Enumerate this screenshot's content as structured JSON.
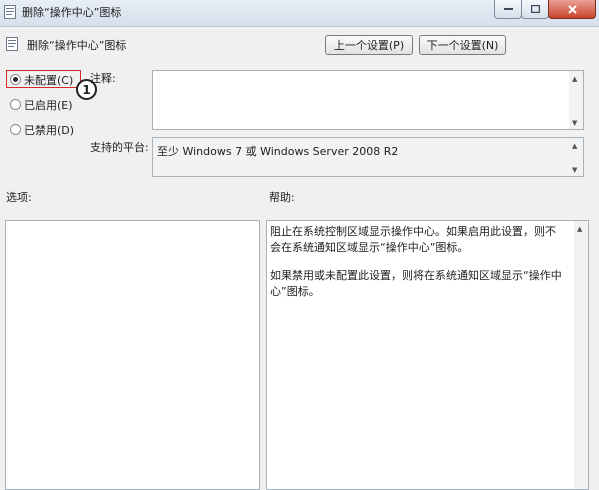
{
  "window": {
    "title": "删除“操作中心”图标"
  },
  "header": {
    "title": "删除“操作中心”图标",
    "prev_button": "上一个设置(P)",
    "next_button": "下一个设置(N)"
  },
  "radios": {
    "not_configured": "未配置(C)",
    "enabled": "已启用(E)",
    "disabled": "已禁用(D)"
  },
  "annotation": {
    "callout_number": "1"
  },
  "comment": {
    "label": "注释:"
  },
  "platform": {
    "label": "支持的平台:",
    "value": "至少 Windows 7 或 Windows Server 2008 R2"
  },
  "options": {
    "label": "选项:"
  },
  "help": {
    "label": "帮助:",
    "paragraph1": "阻止在系统控制区域显示操作中心。如果启用此设置，则不会在系统通知区域显示“操作中心”图标。",
    "paragraph2": "如果禁用或未配置此设置，则将在系统通知区域显示“操作中心”图标。"
  }
}
